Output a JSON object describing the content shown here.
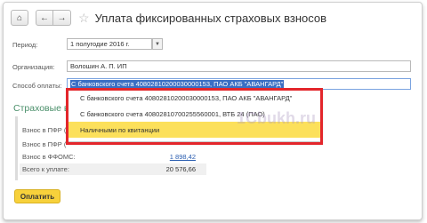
{
  "window": {
    "title": "Уплата фиксированных страховых взносов"
  },
  "toolbar": {
    "home_icon": "⌂",
    "back_icon": "←",
    "forward_icon": "→",
    "star_icon": "☆"
  },
  "form": {
    "period_label": "Период:",
    "period_value": "1 полугодие 2016 г.",
    "org_label": "Организация:",
    "org_value": "Волошин А. П. ИП",
    "payment_label": "Способ оплаты:",
    "payment_value": "С банковского счета 40802810200030000153, ПАО АКБ \"АВАНГАРД\""
  },
  "dropdown": {
    "items": [
      "С банковского счета 40802810200030000153, ПАО АКБ \"АВАНГАРД\"",
      "С банковского счета 40802810700255560001, ВТБ 24 (ПАО)",
      "Наличными по квитанции"
    ]
  },
  "contributions": {
    "section_title": "Страховые в",
    "rows": [
      {
        "label": "Взнос в ПФР (",
        "amount": ""
      },
      {
        "label": "Взнос в ПФР (",
        "amount": ""
      },
      {
        "label": "Взнос в ФФОМС:",
        "amount": "1 898,42"
      }
    ],
    "total_label": "Всего к уплате:",
    "total_value": "20 576,66"
  },
  "actions": {
    "pay_label": "Оплатить"
  },
  "watermark": "1Cbukh.ru",
  "colors": {
    "accent_yellow": "#fce05b",
    "highlight_red": "#e3262b",
    "selection_blue": "#3a6fc4",
    "section_green": "#4a8f6a"
  }
}
